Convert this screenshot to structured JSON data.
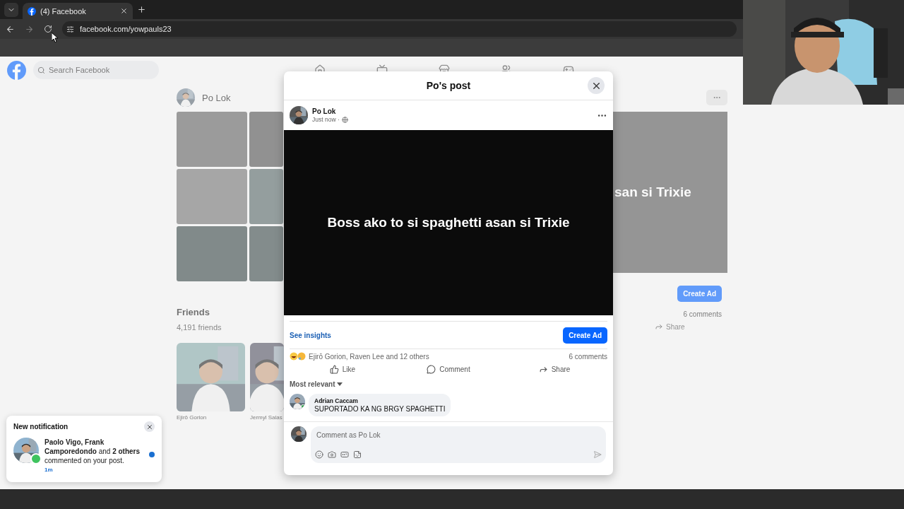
{
  "browser": {
    "tab": {
      "title": "(4) Facebook",
      "selected": true
    },
    "address": "facebook.com/yowpauls23"
  },
  "background": {
    "search_placeholder": "Search Facebook",
    "profile_name": "Po Lok",
    "friends": {
      "title": "Friends",
      "count": "4,191 friends",
      "cards": [
        {
          "name": "Ejirō Gorion"
        },
        {
          "name": "Jermyl Salas"
        }
      ]
    },
    "post": {
      "image_text": "san si Trixie",
      "create_ad": "Create Ad",
      "comments": "6 comments",
      "share": "Share"
    }
  },
  "modal": {
    "title": "Po's post",
    "author": "Po Lok",
    "time": "Just now ·",
    "media_text": "Boss ako to si spaghetti asan si Trixie",
    "insights": "See insights",
    "create_ad": "Create Ad",
    "reactions": "Ejirō Gorion, Raven Lee and 12 others",
    "comments_count": "6 comments",
    "actions": [
      {
        "label": "Like",
        "kind": "like"
      },
      {
        "label": "Comment",
        "kind": "comment"
      },
      {
        "label": "Share",
        "kind": "share"
      }
    ],
    "sort": "Most relevant",
    "comments": [
      {
        "author": "Adrian Caccam",
        "text": "SUPORTADO KA NG BRGY SPAGHETTI",
        "online": true
      }
    ],
    "composer": {
      "placeholder": "Comment as Po Lok"
    }
  },
  "notification": {
    "heading": "New notification",
    "text": "**Paolo Vigo, Frank Camporedondo** and **2 others** commented on your post.",
    "time": "1m",
    "unread": true
  }
}
